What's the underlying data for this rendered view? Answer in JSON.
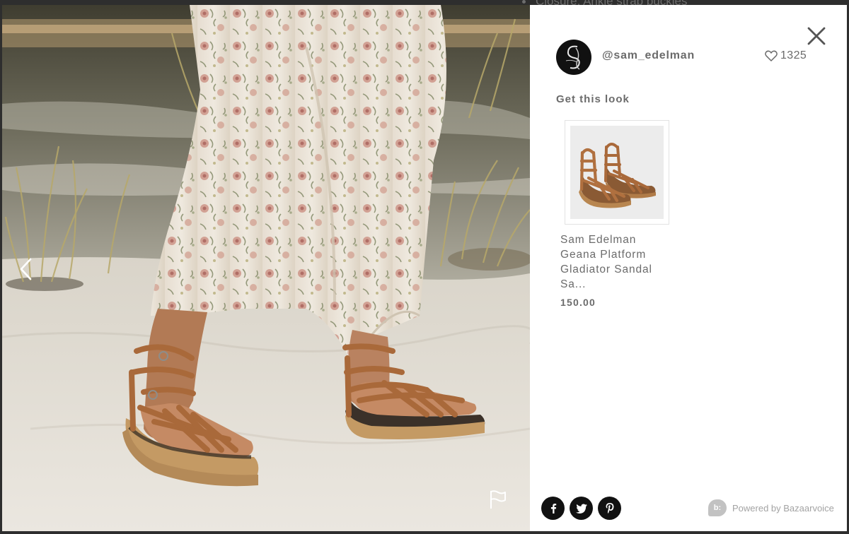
{
  "backdrop": {
    "text": "Closure: Ankle strap buckles"
  },
  "photo": {
    "alt": "Woman in floral maxi skirt walking on sand wearing brown platform gladiator sandals",
    "prev_icon": "chevron-left-icon",
    "flag_icon": "flag-icon"
  },
  "header": {
    "username": "@sam_edelman",
    "likes": "1325",
    "like_icon": "heart-icon",
    "close_icon": "close-icon"
  },
  "look": {
    "heading": "Get this look",
    "products": [
      {
        "name": "Sam Edelman Geana Platform Gladiator Sandal Sa...",
        "price": "150.00"
      }
    ]
  },
  "footer": {
    "share": [
      {
        "network": "facebook",
        "glyph": "f",
        "icon": "facebook-icon"
      },
      {
        "network": "twitter",
        "glyph": "",
        "icon": "twitter-icon"
      },
      {
        "network": "pinterest",
        "glyph": "p",
        "icon": "pinterest-icon"
      }
    ],
    "powered_badge": "b:",
    "powered_text": "Powered by Bazaarvoice"
  },
  "colors": {
    "text_gray": "#6b6b6b",
    "muted_gray": "#a3a3a3",
    "social_bg": "#111111",
    "sandal_brown": "#a9693a"
  }
}
